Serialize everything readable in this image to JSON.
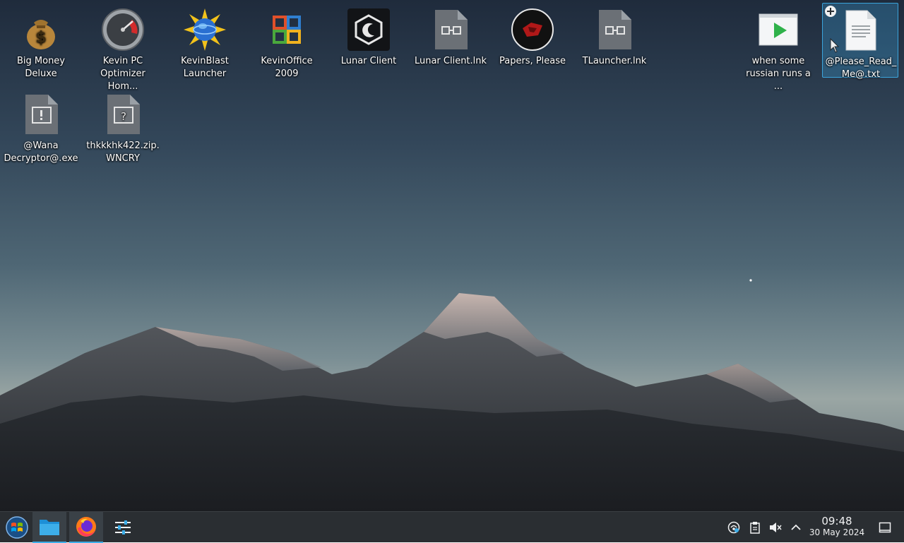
{
  "desktop": {
    "icons": [
      {
        "label": "Big Money\nDeluxe",
        "icon": "money-bag-icon"
      },
      {
        "label": "Kevin PC\nOptimizer Hom...",
        "icon": "speedometer-icon"
      },
      {
        "label": "KevinBlast\nLauncher",
        "icon": "globe-sun-icon"
      },
      {
        "label": "KevinOffice 2009",
        "icon": "office-logo-icon"
      },
      {
        "label": "Lunar Client",
        "icon": "lunar-client-icon"
      },
      {
        "label": "Lunar Client.lnk",
        "icon": "shortcut-file-icon"
      },
      {
        "label": "Papers, Please",
        "icon": "papers-please-icon"
      },
      {
        "label": "TLauncher.lnk",
        "icon": "shortcut-file-icon"
      },
      {
        "label": "when some\nrussian runs a ...",
        "icon": "video-file-icon"
      },
      {
        "label": "@Please_Read_\nMe@.txt",
        "icon": "text-file-icon"
      },
      {
        "label": "@Wana\nDecryptor@.exe",
        "icon": "executable-file-icon"
      },
      {
        "label": "thkkkhk422.zip.\nWNCRY",
        "icon": "unknown-file-icon"
      }
    ]
  },
  "taskbar": {
    "launcher_icon": "start-orb-icon",
    "tasks": [
      {
        "name": "file-manager",
        "icon": "folder-icon"
      },
      {
        "name": "firefox",
        "icon": "firefox-icon"
      },
      {
        "name": "settings",
        "icon": "settings-sliders-icon"
      }
    ],
    "tray": {
      "icons": [
        "network-icon",
        "clipboard-icon",
        "volume-muted-icon",
        "chevron-up-icon"
      ],
      "time": "09:48",
      "date": "30 May 2024",
      "show_desktop_icon": "show-desktop-icon"
    }
  },
  "colors": {
    "accent": "#3daee9",
    "taskbar": "#2a2e32"
  }
}
